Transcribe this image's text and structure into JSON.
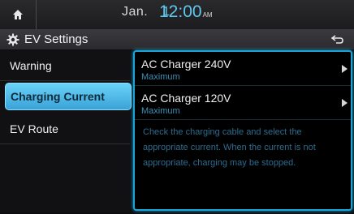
{
  "status": {
    "month": "Jan.",
    "day": "1",
    "time": "12:00",
    "ampm": "AM"
  },
  "title": {
    "label": "EV Settings"
  },
  "menu": {
    "items": [
      {
        "label": "Warning",
        "selected": false
      },
      {
        "label": "Charging Current",
        "selected": true
      },
      {
        "label": "EV Route",
        "selected": false
      }
    ]
  },
  "panel": {
    "options": [
      {
        "title": "AC Charger 240V",
        "subtitle": "Maximum"
      },
      {
        "title": "AC Charger 120V",
        "subtitle": "Maximum"
      }
    ],
    "notice": "Check the charging cable and select the appropriate current. When the current is not appropriate, charging may be stopped."
  },
  "colors": {
    "accent": "#1aa4d8",
    "selected_bg": "#4fbfee",
    "time_color": "#5ec8f0"
  },
  "icons": {
    "home": "home-icon",
    "settings": "gear-icon",
    "back": "back-arrow-icon",
    "option_arrow": "chevron-right-icon"
  }
}
